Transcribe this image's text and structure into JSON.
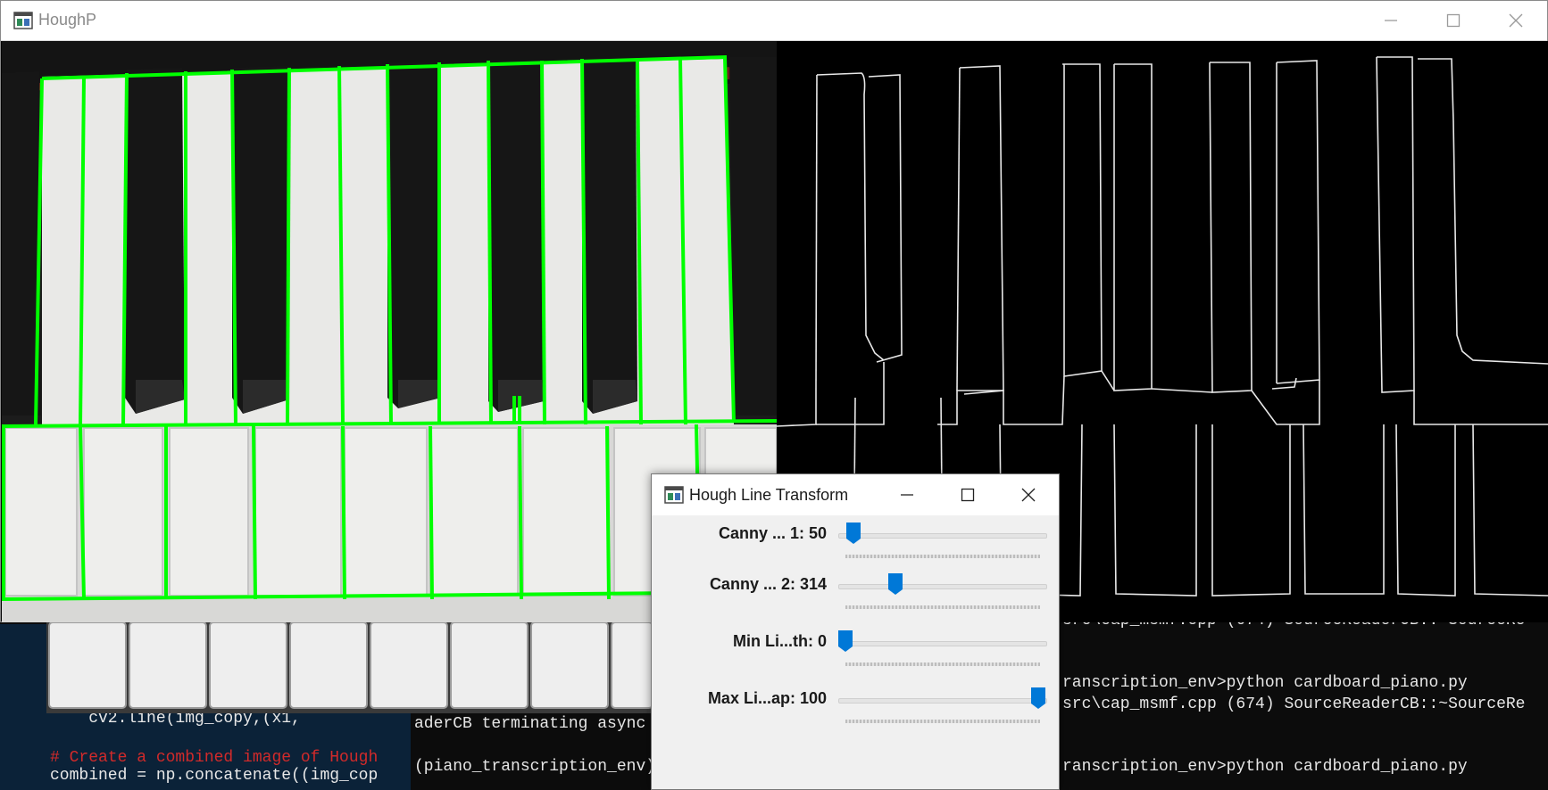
{
  "background_editor": {
    "lines": [
      "    cv2.line(img_copy,(x1,",
      "# Create a combined image of Hough",
      "combined = np.concatenate((img_cop"
    ]
  },
  "background_terminal": {
    "lines": [
      "src\\cap_msmf.cpp (674) SourceReaderCB::~SourceRe",
      "ranscription_env>python cardboard_piano.py",
      "src\\cap_msmf.cpp (674) SourceReaderCB::~SourceRe",
      "aderCB terminating async",
      "(piano_transcription_env)",
      "ranscription_env>python cardboard_piano.py"
    ]
  },
  "hough_window": {
    "title": "HoughP",
    "icon": "opencv-window-icon",
    "controls": [
      "minimize-icon",
      "maximize-icon",
      "close-icon"
    ],
    "left_pane": "piano-keyboard-with-green-hough-lines",
    "right_pane": "canny-edge-map",
    "line_color": "#00ff00"
  },
  "dialog": {
    "title": "Hough Line Transform",
    "trackbars": [
      {
        "label": "Canny ... 1: 50",
        "value": 50,
        "fraction": 0.04
      },
      {
        "label": "Canny ... 2: 314",
        "value": 314,
        "fraction": 0.26
      },
      {
        "label": "Min Li...th: 0",
        "value": 0,
        "fraction": 0.0
      },
      {
        "label": "Max Li...ap: 100",
        "value": 100,
        "fraction": 1.0
      }
    ],
    "thumb_color": "#0078d7"
  }
}
